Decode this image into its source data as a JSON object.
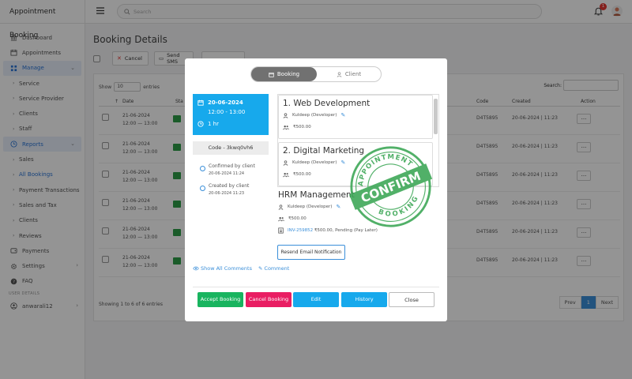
{
  "app": {
    "title": "Appointment Booking"
  },
  "search": {
    "placeholder": "Search"
  },
  "notifications": {
    "count": "1"
  },
  "sidebar": {
    "items": [
      {
        "label": "Dashboard"
      },
      {
        "label": "Appointments"
      },
      {
        "label": "Manage"
      },
      {
        "label": "Service"
      },
      {
        "label": "Service Provider"
      },
      {
        "label": "Clients"
      },
      {
        "label": "Staff"
      },
      {
        "label": "Reports"
      },
      {
        "label": "Sales"
      },
      {
        "label": "All Bookings"
      },
      {
        "label": "Payment Transactions"
      },
      {
        "label": "Sales and Tax"
      },
      {
        "label": "Clients"
      },
      {
        "label": "Reviews"
      },
      {
        "label": "Payments"
      },
      {
        "label": "Settings"
      },
      {
        "label": "FAQ"
      }
    ],
    "section_user": "USER DETAILS",
    "user": "anwarali12"
  },
  "page": {
    "title": "Booking Details",
    "cancel_label": "Cancel",
    "send_label": "Send SMS",
    "show_label": "Show",
    "show_value": "10",
    "entries_label": "entries",
    "search_label": "Search:",
    "columns": {
      "date": "Date",
      "status": "Sta",
      "code": "Code",
      "created": "Created",
      "action": "Action"
    },
    "rows": [
      {
        "date": "21-06-2024",
        "time": "12:00 — 13:00",
        "code": "D4T5895",
        "created": "20-06-2024 | 11:23"
      },
      {
        "date": "21-06-2024",
        "time": "12:00 — 13:00",
        "code": "D4T5895",
        "created": "20-06-2024 | 11:23"
      },
      {
        "date": "21-06-2024",
        "time": "12:00 — 13:00",
        "code": "D4T5895",
        "created": "20-06-2024 | 11:23"
      },
      {
        "date": "21-06-2024",
        "time": "12:00 — 13:00",
        "code": "D4T5895",
        "created": "20-06-2024 | 11:23"
      },
      {
        "date": "21-06-2024",
        "time": "12:00 — 13:00",
        "code": "D4T5895",
        "created": "20-06-2024 | 11:23"
      },
      {
        "date": "21-06-2024",
        "time": "12:00 — 13:00",
        "code": "D4T5895",
        "created": "20-06-2024 | 11:23"
      }
    ],
    "action_label": "...",
    "footer_info": "Showing 1 to 6 of 6 entries",
    "pager": {
      "prev": "Prev",
      "page": "1",
      "next": "Next"
    }
  },
  "modal": {
    "tabs": {
      "booking": "Booking",
      "client": "Client"
    },
    "date": "20-06-2024",
    "time": "12:00 - 13:00",
    "duration": "1 hr",
    "code": "Code - 3kwq0vh6",
    "timeline": [
      {
        "label": "Confirmed by client",
        "time": "20-06-2024 11:24"
      },
      {
        "label": "Created by client",
        "time": "20-06-2024 11:23"
      }
    ],
    "services": [
      {
        "title": "1. Web Development",
        "provider": "Kuldeep (Developer)",
        "price": "₹500.00"
      },
      {
        "title": "2. Digital Marketing",
        "provider": "Kuldeep (Developer)",
        "price": "₹500.00"
      }
    ],
    "hrm": {
      "title": "HRM Management",
      "provider": "Kuldeep (Developer)",
      "price": "₹500.00",
      "invoice": "INV-259852",
      "invoice_detail": "₹500.00, Pending (Pay Later)"
    },
    "resend_label": "Resend Email Notification",
    "show_comments": "Show All Comments",
    "comment": "Comment",
    "buttons": {
      "accept": "Accept Booking",
      "cancel": "Cancel Booking",
      "edit": "Edit",
      "history": "History",
      "close": "Close"
    },
    "stamp": {
      "top": "APPOINTMENT",
      "center": "CONFIRM",
      "bottom": "BOOKING"
    }
  },
  "colors": {
    "primary": "#17a9ec",
    "accept": "#19b45f",
    "cancel": "#e91e63",
    "stamp": "#3aa654"
  }
}
